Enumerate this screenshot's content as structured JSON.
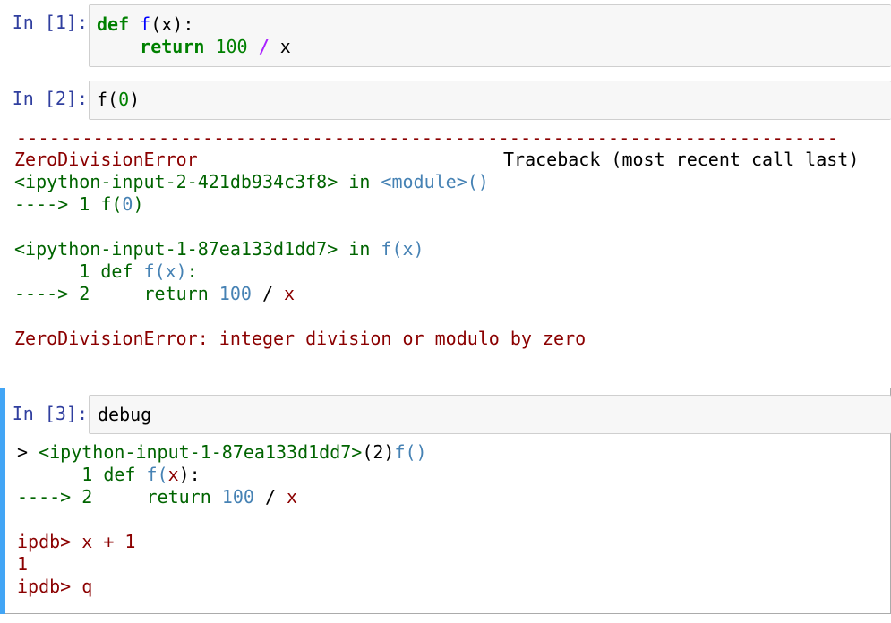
{
  "cells": [
    {
      "prompt": "In [1]:",
      "lines": [
        {
          "indent": "",
          "kw": "def",
          "sp": " ",
          "fn": "f",
          "rest": "(x):"
        },
        {
          "indent": "    ",
          "kw": "return",
          "sp": " ",
          "num": "100",
          "op": "/",
          "var": "x"
        }
      ]
    },
    {
      "prompt": "In [2]:",
      "code": {
        "fn": "f",
        "open": "(",
        "arg": "0",
        "close": ")"
      },
      "output": {
        "separator": "---------------------------------------------------------------------------",
        "error_name": "ZeroDivisionError",
        "traceback_header": "Traceback (most recent call last)",
        "frame1_file": "<ipython-input-2-421db934c3f8>",
        "frame1_in": " in ",
        "frame1_module": "<module>",
        "frame1_parens": "()",
        "frame1_line_arrow": "----> 1 ",
        "frame1_line_code_fn": "f",
        "frame1_line_code_open": "(",
        "frame1_line_code_arg": "0",
        "frame1_line_code_close": ")",
        "frame2_file": "<ipython-input-1-87ea133d1dd7>",
        "frame2_in": " in ",
        "frame2_func": "f",
        "frame2_args": "(x)",
        "frame2_l1_num": "      1 ",
        "frame2_l1_def": "def ",
        "frame2_l1_fn": "f",
        "frame2_l1_args": "(x)",
        "frame2_l1_colon": ":",
        "frame2_l2_arrow": "----> 2 ",
        "frame2_l2_return": "    return ",
        "frame2_l2_num": "100",
        "frame2_l2_op": " / ",
        "frame2_l2_var": "x",
        "final_error": "ZeroDivisionError",
        "final_message": ": integer division or modulo by zero"
      }
    },
    {
      "prompt": "In [3]:",
      "code": "debug",
      "output": {
        "loc_marker": "> ",
        "loc_file": "<ipython-input-1-87ea133d1dd7>",
        "loc_line": "(2)",
        "loc_func": "f",
        "loc_parens": "()",
        "l1_num": "      1 ",
        "l1_def": "def ",
        "l1_fn": "f",
        "l1_args_open": "(",
        "l1_args_x": "x",
        "l1_args_close": "):",
        "l2_arrow": "----> 2 ",
        "l2_return": "    return ",
        "l2_num": "100",
        "l2_op": " / ",
        "l2_var": "x",
        "cmd1_prompt": "ipdb> ",
        "cmd1": "x + 1",
        "result1": "1",
        "cmd2_prompt": "ipdb> ",
        "cmd2": "q"
      }
    }
  ],
  "colors": {
    "prompt": "#303f9f",
    "selected_bar": "#42a5f5",
    "error": "#8b0000"
  }
}
